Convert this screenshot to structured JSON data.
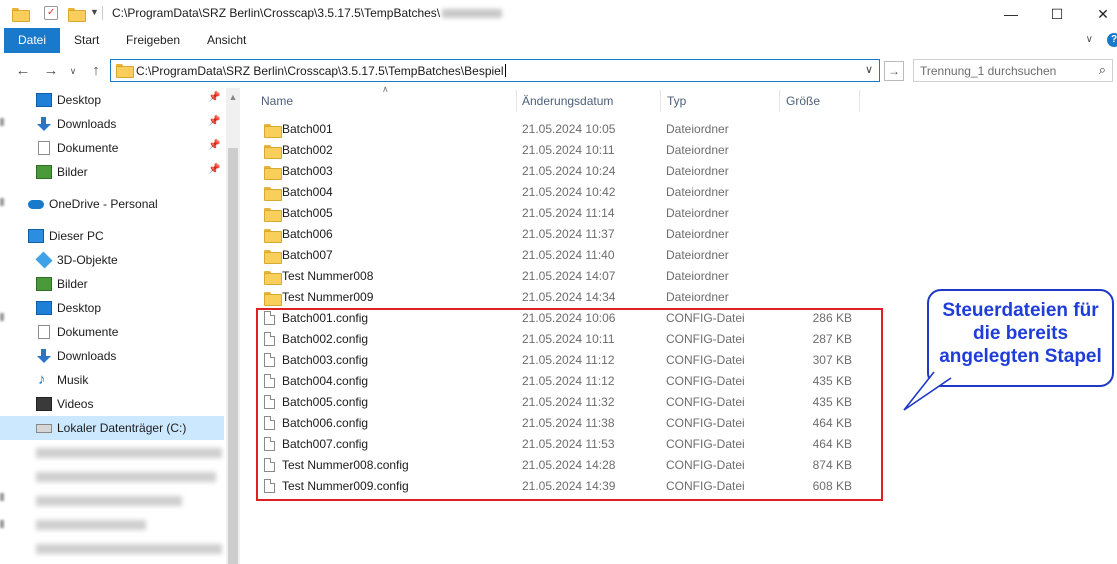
{
  "titlebar": {
    "path": "C:\\ProgramData\\SRZ Berlin\\Crosscap\\3.5.17.5\\TempBatches\\",
    "minimize": "—",
    "maximize": "☐",
    "close": "✕"
  },
  "ribbon": {
    "tabs": [
      "Datei",
      "Start",
      "Freigeben",
      "Ansicht"
    ],
    "help": "?"
  },
  "address": {
    "path": "C:\\ProgramData\\SRZ Berlin\\Crosscap\\3.5.17.5\\TempBatches\\Bespiel",
    "search_placeholder": "Trennung_1 durchsuchen"
  },
  "nav": {
    "quick_access": [
      {
        "label": "Desktop",
        "icon": "desktop-icon"
      },
      {
        "label": "Downloads",
        "icon": "download-icon"
      },
      {
        "label": "Dokumente",
        "icon": "document-icon"
      },
      {
        "label": "Bilder",
        "icon": "picture-icon"
      }
    ],
    "onedrive": "OneDrive - Personal",
    "this_pc": "Dieser PC",
    "pc_items": [
      {
        "label": "3D-Objekte",
        "icon": "3d-objects-icon"
      },
      {
        "label": "Bilder",
        "icon": "picture-icon"
      },
      {
        "label": "Desktop",
        "icon": "desktop-icon"
      },
      {
        "label": "Dokumente",
        "icon": "document-icon"
      },
      {
        "label": "Downloads",
        "icon": "download-icon"
      },
      {
        "label": "Musik",
        "icon": "music-icon"
      },
      {
        "label": "Videos",
        "icon": "video-icon"
      },
      {
        "label": "Lokaler Datenträger (C:)",
        "icon": "drive-icon"
      }
    ]
  },
  "columns": {
    "name": "Name",
    "date": "Änderungsdatum",
    "type": "Typ",
    "size": "Größe"
  },
  "files": [
    {
      "name": "Batch001",
      "date": "21.05.2024 10:05",
      "type": "Dateiordner",
      "size": "",
      "kind": "folder"
    },
    {
      "name": "Batch002",
      "date": "21.05.2024 10:11",
      "type": "Dateiordner",
      "size": "",
      "kind": "folder"
    },
    {
      "name": "Batch003",
      "date": "21.05.2024 10:24",
      "type": "Dateiordner",
      "size": "",
      "kind": "folder"
    },
    {
      "name": "Batch004",
      "date": "21.05.2024 10:42",
      "type": "Dateiordner",
      "size": "",
      "kind": "folder"
    },
    {
      "name": "Batch005",
      "date": "21.05.2024 11:14",
      "type": "Dateiordner",
      "size": "",
      "kind": "folder"
    },
    {
      "name": "Batch006",
      "date": "21.05.2024 11:37",
      "type": "Dateiordner",
      "size": "",
      "kind": "folder"
    },
    {
      "name": "Batch007",
      "date": "21.05.2024 11:40",
      "type": "Dateiordner",
      "size": "",
      "kind": "folder"
    },
    {
      "name": "Test Nummer008",
      "date": "21.05.2024 14:07",
      "type": "Dateiordner",
      "size": "",
      "kind": "folder"
    },
    {
      "name": "Test Nummer009",
      "date": "21.05.2024 14:34",
      "type": "Dateiordner",
      "size": "",
      "kind": "folder"
    },
    {
      "name": "Batch001.config",
      "date": "21.05.2024 10:06",
      "type": "CONFIG-Datei",
      "size": "286 KB",
      "kind": "file"
    },
    {
      "name": "Batch002.config",
      "date": "21.05.2024 10:11",
      "type": "CONFIG-Datei",
      "size": "287 KB",
      "kind": "file"
    },
    {
      "name": "Batch003.config",
      "date": "21.05.2024 11:12",
      "type": "CONFIG-Datei",
      "size": "307 KB",
      "kind": "file"
    },
    {
      "name": "Batch004.config",
      "date": "21.05.2024 11:12",
      "type": "CONFIG-Datei",
      "size": "435 KB",
      "kind": "file"
    },
    {
      "name": "Batch005.config",
      "date": "21.05.2024 11:32",
      "type": "CONFIG-Datei",
      "size": "435 KB",
      "kind": "file"
    },
    {
      "name": "Batch006.config",
      "date": "21.05.2024 11:38",
      "type": "CONFIG-Datei",
      "size": "464 KB",
      "kind": "file"
    },
    {
      "name": "Batch007.config",
      "date": "21.05.2024 11:53",
      "type": "CONFIG-Datei",
      "size": "464 KB",
      "kind": "file"
    },
    {
      "name": "Test Nummer008.config",
      "date": "21.05.2024 14:28",
      "type": "CONFIG-Datei",
      "size": "874 KB",
      "kind": "file"
    },
    {
      "name": "Test Nummer009.config",
      "date": "21.05.2024 14:39",
      "type": "CONFIG-Datei",
      "size": "608 KB",
      "kind": "file"
    }
  ],
  "annotation": {
    "lines": [
      "Steuerdateien für",
      "die bereits",
      "angelegten Stapel"
    ],
    "border_color": "#e02020",
    "text_color": "#1f3dd8"
  }
}
